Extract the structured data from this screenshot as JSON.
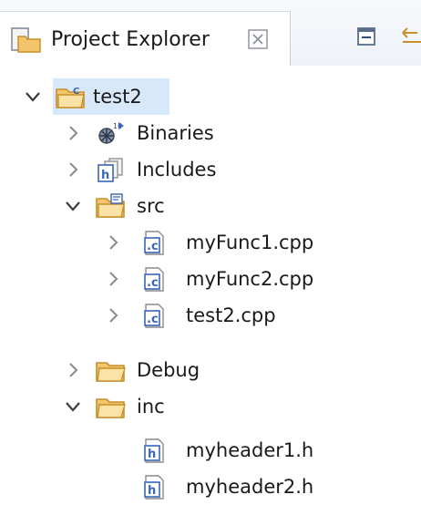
{
  "view": {
    "tab_label": "Project Explorer",
    "close_glyph": "⨯"
  },
  "tree": {
    "root": "test2",
    "binaries": "Binaries",
    "includes": "Includes",
    "src": "src",
    "src_files": [
      "myFunc1.cpp",
      "myFunc2.cpp",
      "test2.cpp"
    ],
    "debug": "Debug",
    "inc": "inc",
    "inc_files": [
      "myheader1.h",
      "myheader2.h"
    ]
  },
  "icons": {
    "tab": "project-explorer-icon",
    "collapse_all": "collapse-all-icon",
    "link_with_editor": "link-with-editor-icon",
    "project": "c-project-folder-icon",
    "binaries": "binaries-icon",
    "includes": "includes-icon",
    "source_folder": "source-folder-icon",
    "folder": "folder-icon",
    "c_source_file": "c-source-file-icon",
    "header_file": "header-file-icon"
  },
  "colors": {
    "selection": "#d8e8fb",
    "folder": "#f2c46b",
    "folder_dark": "#c7902a",
    "file_blue": "#3a66b8"
  }
}
